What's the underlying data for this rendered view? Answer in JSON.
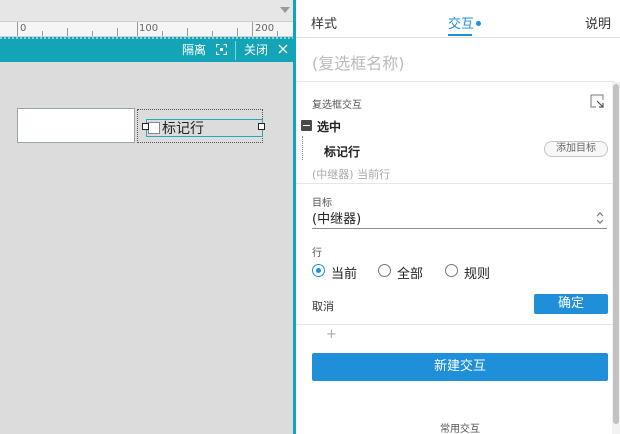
{
  "ruler": {
    "labels": [
      "0",
      "100",
      "200"
    ],
    "arrow_icon": "triangle-down-icon"
  },
  "canvas_toolbar": {
    "isolate_label": "隔离",
    "isolate_icon": "focus-frame-icon",
    "close_label": "关闭",
    "close_icon": "close-x-icon"
  },
  "canvas": {
    "checkbox_widget_label": "标记行"
  },
  "panel": {
    "tabs": [
      {
        "label": "样式",
        "active": false
      },
      {
        "label": "交互",
        "active": true
      },
      {
        "label": "说明",
        "active": false
      }
    ],
    "widget_name_placeholder": "(复选框名称)",
    "section_title": "复选框交互",
    "collapse_icon": "collapse-corner-icon",
    "event": {
      "label": "选中",
      "toggle_icon": "minus-box-icon",
      "action": {
        "label": "标记行",
        "add_target_label": "添加目标"
      },
      "summary": "(中继器) 当前行"
    },
    "target": {
      "label": "目标",
      "value": "(中继器)",
      "arrow_icon": "updown-chevron-icon"
    },
    "row": {
      "label": "行",
      "options": [
        {
          "label": "当前",
          "checked": true
        },
        {
          "label": "全部",
          "checked": false
        },
        {
          "label": "规则",
          "checked": false
        }
      ]
    },
    "cancel_label": "取消",
    "confirm_label": "确定",
    "plus_label": "+",
    "new_interaction_label": "新建交互",
    "common_label": "常用交互"
  },
  "colors": {
    "accent_blue": "#1e8fd8",
    "teal": "#13a4b5",
    "canvas_bg": "#dcdcdc"
  }
}
